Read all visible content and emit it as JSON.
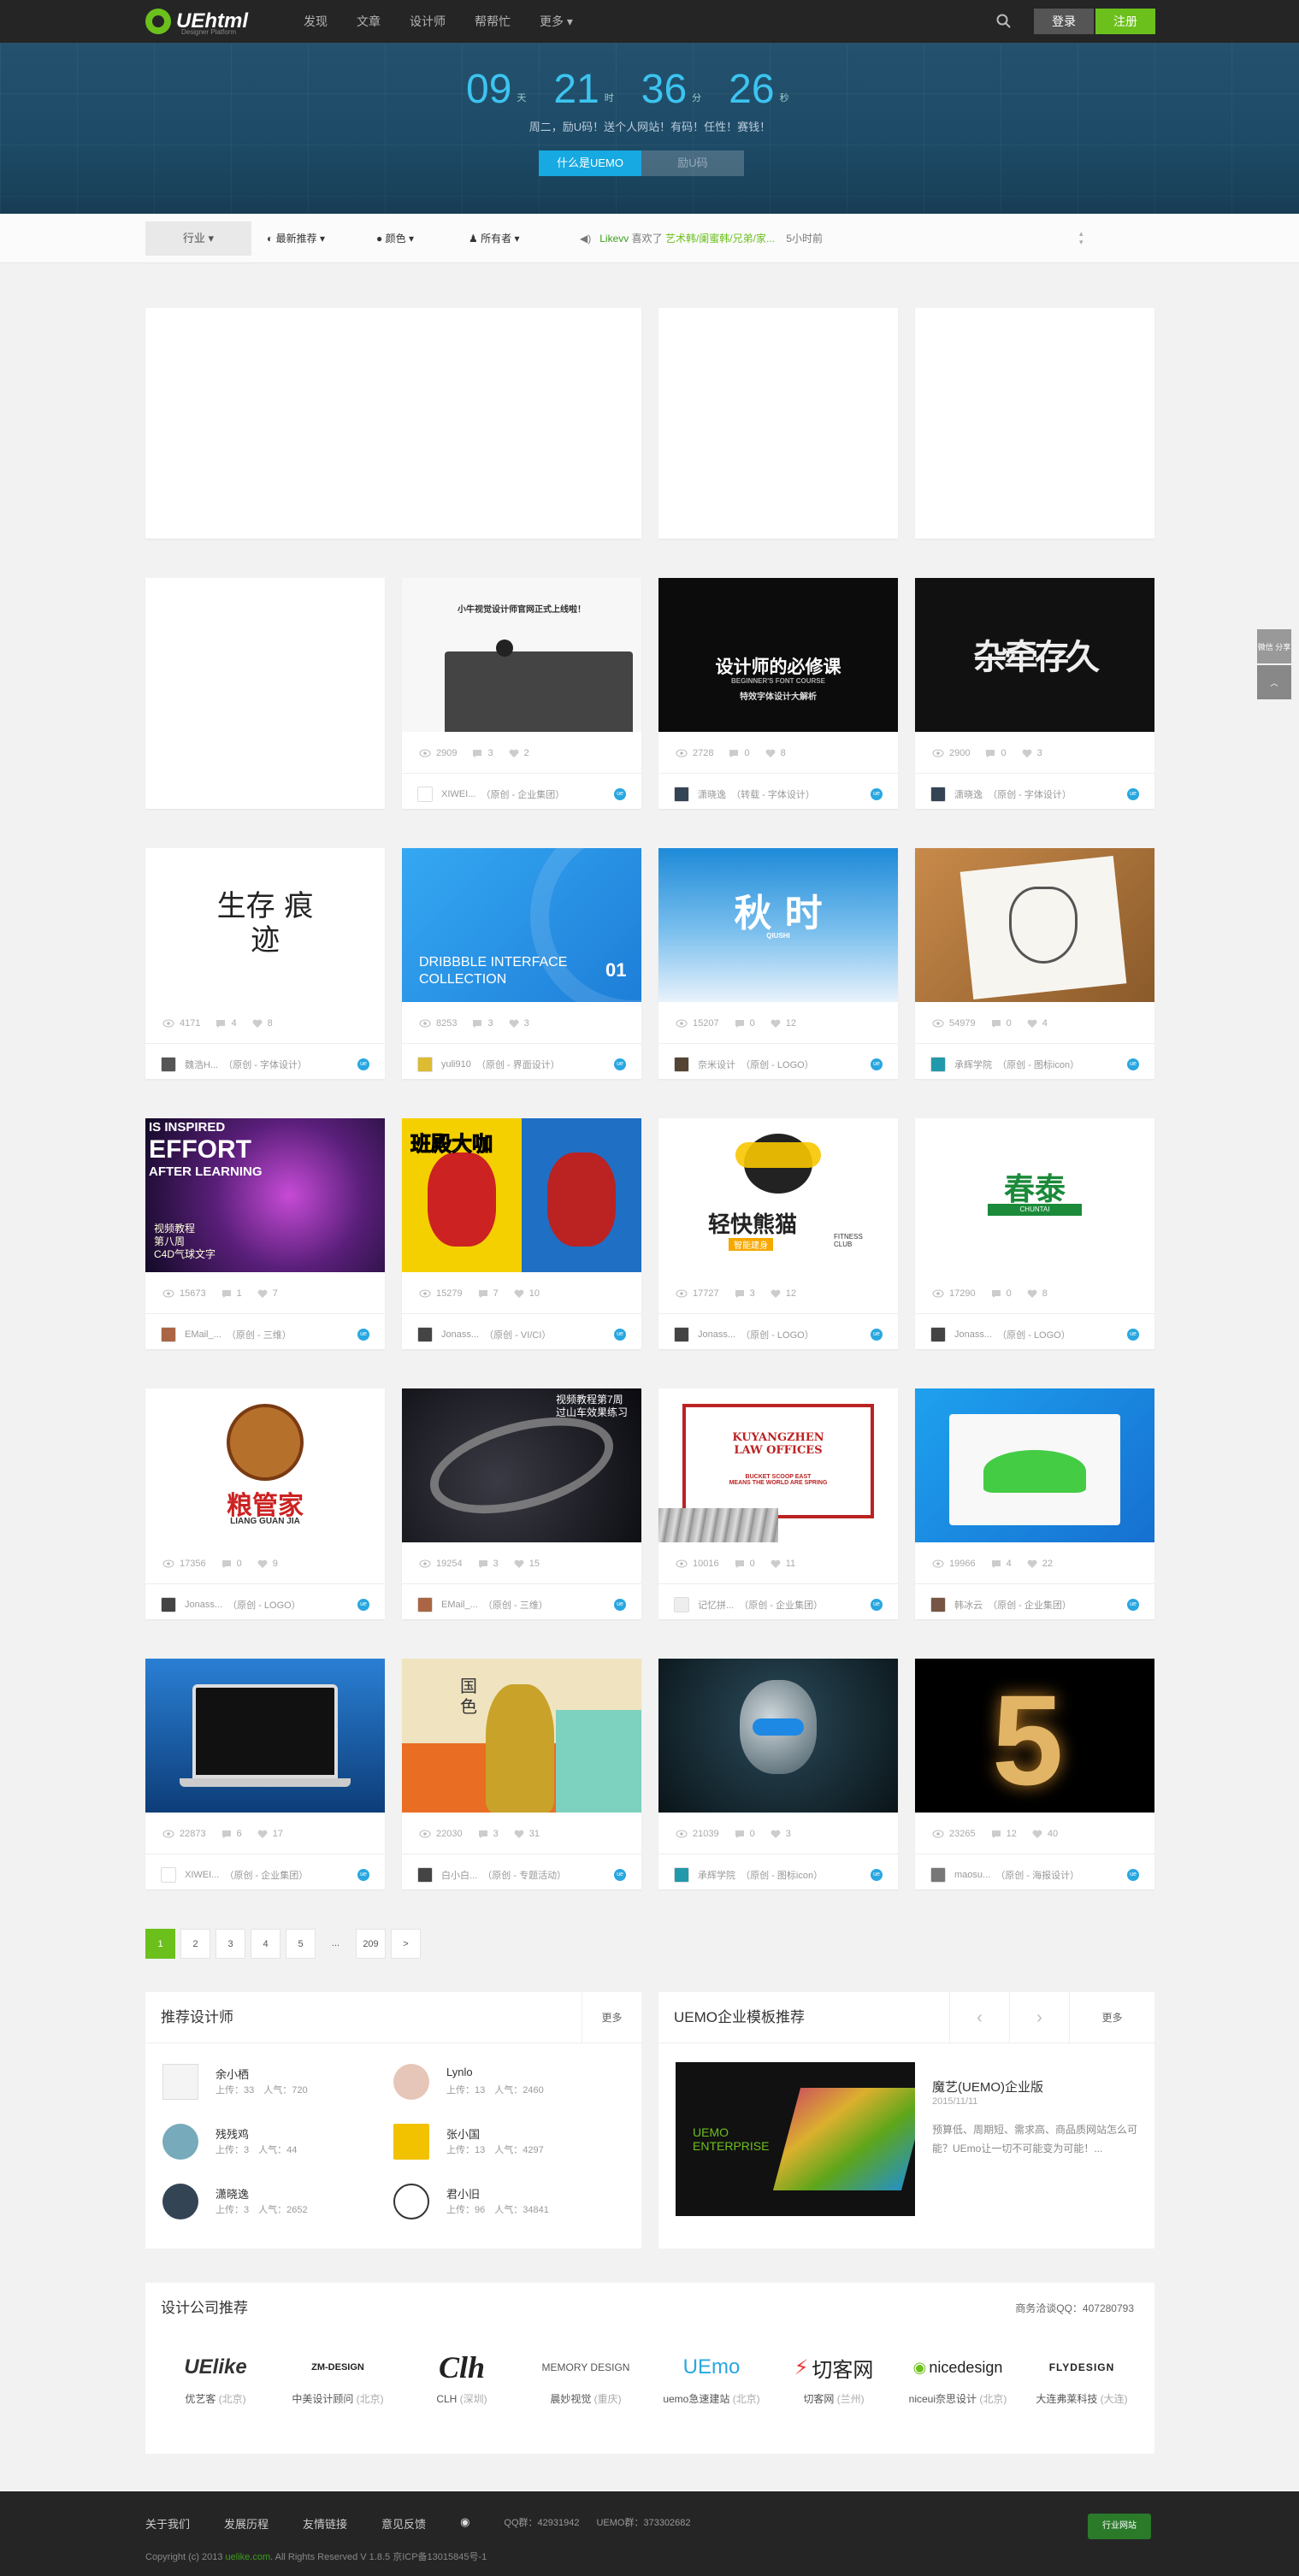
{
  "header": {
    "logo_text": "UEhtml",
    "logo_sub": "Designer Platform",
    "nav": [
      "发现",
      "文章",
      "设计师",
      "帮帮忙",
      "更多"
    ],
    "login": "登录",
    "register": "注册"
  },
  "banner": {
    "countdown": [
      {
        "num": "09",
        "unit": "天"
      },
      {
        "num": "21",
        "unit": "时"
      },
      {
        "num": "36",
        "unit": "分"
      },
      {
        "num": "26",
        "unit": "秒"
      }
    ],
    "tagline": "周二，励U码！送个人网站！有码！任性！赛钱！",
    "btn_active": "什么是UEMO",
    "btn_inactive": "励U码"
  },
  "filter": {
    "industry": "行业",
    "sort": "最新推荐",
    "color": "颜色",
    "owner": "所有者",
    "news_user": "Likevv",
    "news_action": "喜欢了",
    "news_target": "艺术韩/阑蜜韩/兄弟/家...",
    "news_time": "5小时前"
  },
  "cards": [
    {
      "views": "2909",
      "comments": "3",
      "likes": "2",
      "author": "XIWEI...",
      "cat": "（原创 - 企业集团）",
      "avatar": "#fff"
    },
    {
      "views": "2728",
      "comments": "0",
      "likes": "8",
      "author": "潇晓逸",
      "cat": "（转载 - 字体设计）",
      "avatar": "#345"
    },
    {
      "views": "2900",
      "comments": "0",
      "likes": "3",
      "author": "潇晓逸",
      "cat": "（原创 - 字体设计）",
      "avatar": "#345"
    },
    {
      "views": "4171",
      "comments": "4",
      "likes": "8",
      "author": "魏浩H...",
      "cat": "（原创 - 字体设计）",
      "avatar": "#555"
    },
    {
      "views": "8253",
      "comments": "3",
      "likes": "3",
      "author": "yuli910",
      "cat": "（原创 - 界面设计）",
      "avatar": "#db3"
    },
    {
      "views": "15207",
      "comments": "0",
      "likes": "12",
      "author": "奈米设计",
      "cat": "（原创 - LOGO）",
      "avatar": "#543"
    },
    {
      "views": "54979",
      "comments": "0",
      "likes": "4",
      "author": "承辉学院",
      "cat": "（原创 - 图标icon）",
      "avatar": "#29a"
    },
    {
      "views": "15673",
      "comments": "1",
      "likes": "7",
      "author": "EMail_...",
      "cat": "（原创 - 三维）",
      "avatar": "#a64"
    },
    {
      "views": "15279",
      "comments": "7",
      "likes": "10",
      "author": "Jonass...",
      "cat": "（原创 - VI/CI）",
      "avatar": "#444"
    },
    {
      "views": "17727",
      "comments": "3",
      "likes": "12",
      "author": "Jonass...",
      "cat": "（原创 - LOGO）",
      "avatar": "#444"
    },
    {
      "views": "17290",
      "comments": "0",
      "likes": "8",
      "author": "Jonass...",
      "cat": "（原创 - LOGO）",
      "avatar": "#444"
    },
    {
      "views": "17356",
      "comments": "0",
      "likes": "9",
      "author": "Jonass...",
      "cat": "（原创 - LOGO）",
      "avatar": "#444"
    },
    {
      "views": "19254",
      "comments": "3",
      "likes": "15",
      "author": "EMail_...",
      "cat": "（原创 - 三维）",
      "avatar": "#a64"
    },
    {
      "views": "10016",
      "comments": "0",
      "likes": "11",
      "author": "记忆拼...",
      "cat": "（原创 - 企业集团）",
      "avatar": "#eee"
    },
    {
      "views": "19966",
      "comments": "4",
      "likes": "22",
      "author": "韩冰云",
      "cat": "（原创 - 企业集团）",
      "avatar": "#754"
    },
    {
      "views": "22873",
      "comments": "6",
      "likes": "17",
      "author": "XIWEI...",
      "cat": "（原创 - 企业集团）",
      "avatar": "#fff"
    },
    {
      "views": "22030",
      "comments": "3",
      "likes": "31",
      "author": "白小白...",
      "cat": "（原创 - 专题活动）",
      "avatar": "#444"
    },
    {
      "views": "21039",
      "comments": "0",
      "likes": "3",
      "author": "承辉学院",
      "cat": "（原创 - 图标icon）",
      "avatar": "#29a"
    },
    {
      "views": "23265",
      "comments": "12",
      "likes": "40",
      "author": "maosu...",
      "cat": "（原创 - 海报设计）",
      "avatar": "#777"
    }
  ],
  "thumbs": {
    "t1_title": "小牛视觉设计师官网正式上线啦！",
    "t2_title": "设计师的必修课",
    "t2_sub": "BEGINNER'S FONT COURSE",
    "t2_sub2": "特效字体设计大解析",
    "t3_title": "杂牵存久",
    "t4_title": "生存 痕迹",
    "t5_title": "DRIBBBLE INTERFACE COLLECTION",
    "t5_num": "01",
    "t6_title": "秋 时",
    "t6_sub": "QIUSHI",
    "t8_l1": "IS INSPIRED",
    "t8_l2": "EFFORT",
    "t8_l3": "AFTER LEARNING",
    "t8_l4": "视频教程",
    "t8_l5": "第八周",
    "t8_l6": "C4D气球文字",
    "t9_title": "班殿大咖",
    "t10_title": "轻快熊猫",
    "t10_sub": "智能建身",
    "t10_sub2": "FITNESS CLUB",
    "t11_title": "春泰",
    "t11_sub": "CHUNTAI",
    "t12_title": "粮管家",
    "t12_sub": "LIANG GUAN JIA",
    "t13_title": "视频教程第7周",
    "t13_sub": "过山车效果练习",
    "t14_l1": "KUYANGZHEN",
    "t14_l2": "LAW OFFICES",
    "t14_l3": "BUCKET SCOOP EAST",
    "t14_l4": "MEANS THE WORLD ARE SPRING",
    "t17_title": "国 色",
    "t19_num": "5"
  },
  "pagination": [
    "1",
    "2",
    "3",
    "4",
    "5",
    "...",
    "209",
    ">"
  ],
  "designers": {
    "title": "推荐设计师",
    "more": "更多",
    "list": [
      {
        "name": "余小栖",
        "meta": "上传：33　人气：720"
      },
      {
        "name": "Lynlo",
        "meta": "上传：13　人气：2460"
      },
      {
        "name": "残残鸡",
        "meta": "上传：3　人气：44"
      },
      {
        "name": "张小国",
        "meta": "上传：13　人气：4297"
      },
      {
        "name": "潇晓逸",
        "meta": "上传：3　人气：2652"
      },
      {
        "name": "君小旧",
        "meta": "上传：96　人气：34841"
      }
    ]
  },
  "templates": {
    "title": "UEMO企业模板推荐",
    "more": "更多",
    "item_title": "魔艺(UEMO)企业版",
    "item_date": "2015/11/11",
    "item_desc": "预算低、周期短、需求高、商品质网站怎么可能？UEmo让一切不可能变为可能！...",
    "img_text": "UEMO ENTERPRISE"
  },
  "companies": {
    "title": "设计公司推荐",
    "contact": "商务洽谈QQ：407280793",
    "list": [
      {
        "logo": "UElike",
        "name": "优艺客",
        "city": "(北京)"
      },
      {
        "logo": "ZM-DESIGN",
        "name": "中美设计顾问",
        "city": "(北京)"
      },
      {
        "logo": "Clh",
        "name": "CLH",
        "city": "(深圳)"
      },
      {
        "logo": "MEMORY DESIGN",
        "name": "晨妙视觉",
        "city": "(重庆)"
      },
      {
        "logo": "UEmo",
        "name": "uemo急速建站",
        "city": "(北京)"
      },
      {
        "logo": "切客网",
        "name": "切客网",
        "city": "(兰州)"
      },
      {
        "logo": "nicedesign",
        "name": "niceui奈思设计",
        "city": "(北京)"
      },
      {
        "logo": "FLYDESIGN",
        "name": "大连弗莱科技",
        "city": "(大连)"
      }
    ]
  },
  "footer": {
    "links": [
      "关于我们",
      "发展历程",
      "友情链接",
      "意见反馈"
    ],
    "qq1": "QQ群：42931942",
    "qq2": "UEMO群：373302682",
    "copy_pre": "Copyright (c) 2013 ",
    "copy_site": "uelike.com",
    "copy_post": ". All Rights Reserved V 1.8.5 京ICP备13015845号-1",
    "badge": "行业网站"
  },
  "side": {
    "btn1": "微信 分享"
  },
  "colors": {
    "accent": "#6cc01c",
    "blue": "#17a9e1",
    "topbar": "#252525"
  }
}
